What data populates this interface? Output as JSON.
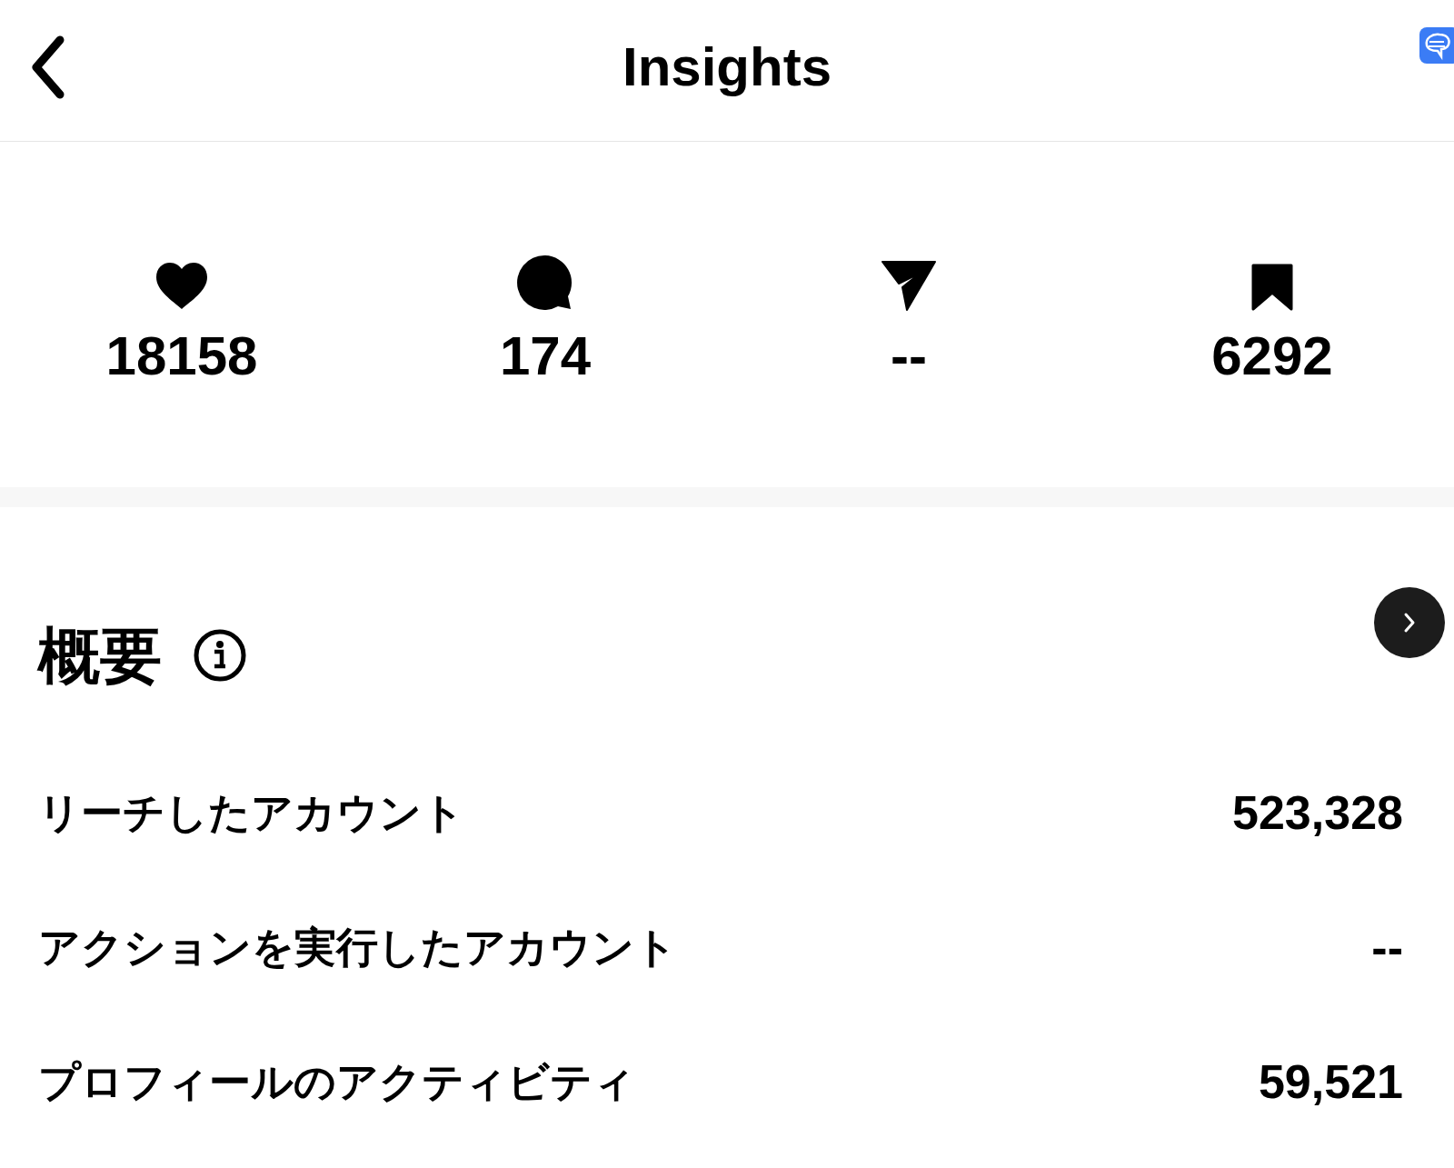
{
  "header": {
    "title": "Insights"
  },
  "stats": [
    {
      "kind": "likes",
      "value": "18158"
    },
    {
      "kind": "comments",
      "value": "174"
    },
    {
      "kind": "shares",
      "value": "--"
    },
    {
      "kind": "saves",
      "value": "6292"
    }
  ],
  "overview": {
    "title": "概要",
    "rows": [
      {
        "label": "リーチしたアカウント",
        "value": "523,328"
      },
      {
        "label": "アクションを実行したアカウント",
        "value": "--"
      },
      {
        "label": "プロフィールのアクティビティ",
        "value": "59,521"
      }
    ]
  }
}
